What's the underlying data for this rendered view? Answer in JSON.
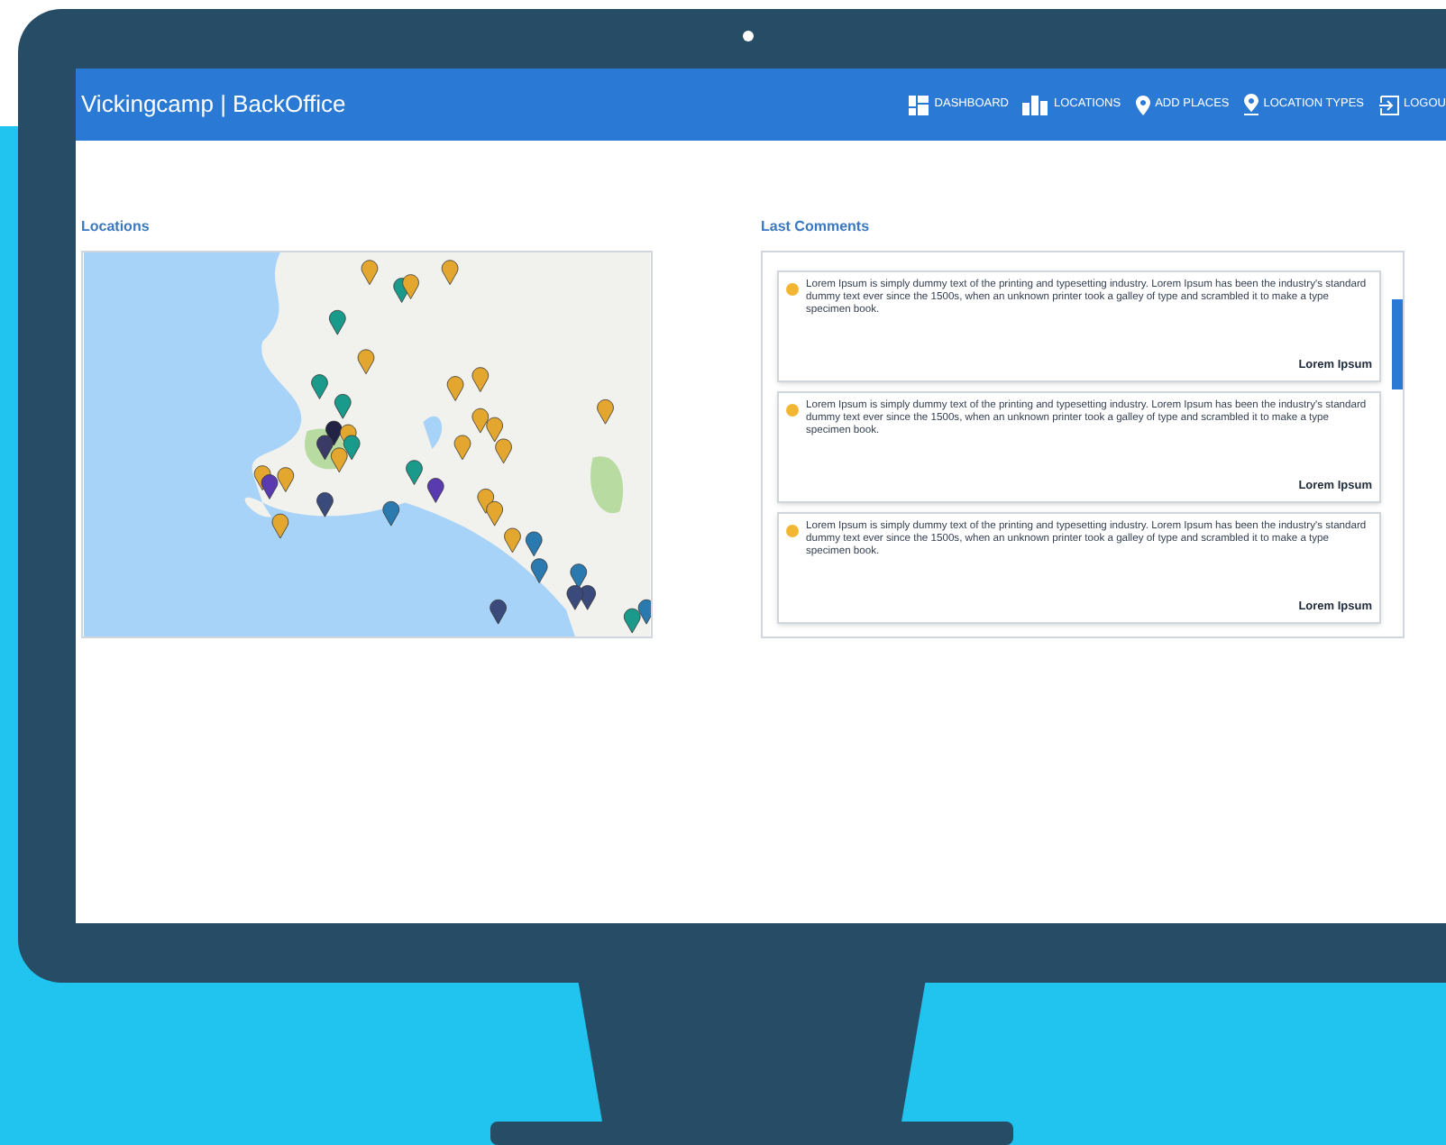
{
  "app": {
    "title": "Vickingcamp | BackOffice"
  },
  "nav": [
    {
      "label": "DASHBOARD",
      "kind": "dashboard"
    },
    {
      "label": "LOCATIONS",
      "kind": "buildings"
    },
    {
      "label": "ADD PLACES",
      "kind": "pin"
    },
    {
      "label": "LOCATION TYPES",
      "kind": "pinline"
    },
    {
      "label": "LOGOU",
      "kind": "logout"
    }
  ],
  "locations": {
    "heading": "Locations"
  },
  "comments": {
    "heading": "Last Comments",
    "items": [
      {
        "text": "Lorem Ipsum is simply dummy text of the printing and typesetting industry. Lorem Ipsum has been the industry's standard dummy text ever since the 1500s, when an unknown printer took a galley of type and scrambled it to make a type specimen book.",
        "author": "Lorem Ipsum"
      },
      {
        "text": "Lorem Ipsum is simply dummy text of the printing and typesetting industry. Lorem Ipsum has been the industry's standard dummy text ever since the 1500s, when an unknown printer took a galley of type and scrambled it to make a type specimen book.",
        "author": "Lorem Ipsum"
      },
      {
        "text": "Lorem Ipsum is simply dummy text of the printing and typesetting industry. Lorem Ipsum has been the industry's standard dummy text ever since the 1500s, when an unknown printer took a galley of type and scrambled it to make a type specimen book.",
        "author": "Lorem Ipsum"
      }
    ]
  }
}
